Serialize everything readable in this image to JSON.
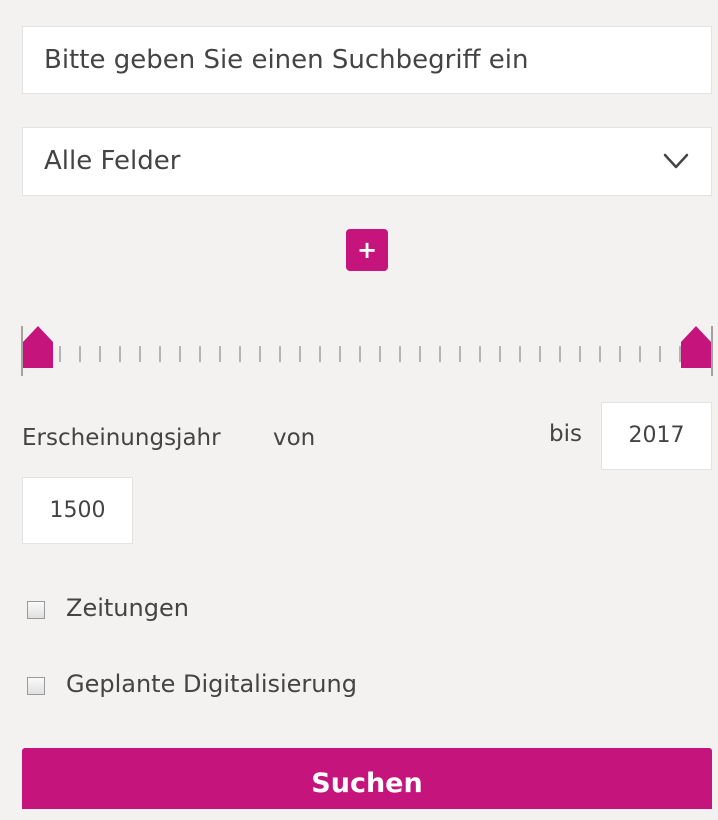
{
  "search": {
    "placeholder": "Bitte geben Sie einen Suchbegriff ein"
  },
  "field_select": {
    "value": "Alle Felder",
    "icon": "chevron-down-icon"
  },
  "add_button": {
    "label": "+"
  },
  "year_range": {
    "label": "Erscheinungsjahr",
    "from_label": "von",
    "to_label": "bis",
    "from_value": "1500",
    "to_value": "2017",
    "min": 1500,
    "max": 2017
  },
  "filters": [
    {
      "label": "Zeitungen",
      "checked": false
    },
    {
      "label": "Geplante Digitalisierung",
      "checked": false
    }
  ],
  "submit": {
    "label": "Suchen"
  },
  "colors": {
    "accent": "#c5147c",
    "background": "#f3f2f1"
  }
}
